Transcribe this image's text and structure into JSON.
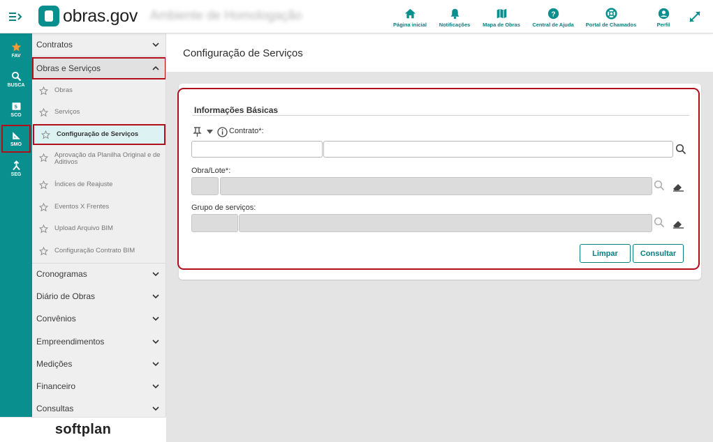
{
  "app": {
    "logo_text": "obras.gov",
    "environment": "Ambiente de Homologação"
  },
  "topnav": [
    {
      "label": "Página inicial",
      "icon": "home-icon"
    },
    {
      "label": "Notificações",
      "icon": "bell-icon"
    },
    {
      "label": "Mapa de Obras",
      "icon": "map-icon"
    },
    {
      "label": "Central de Ajuda",
      "icon": "help-icon"
    },
    {
      "label": "Portal de Chamados",
      "icon": "lifebuoy-icon"
    },
    {
      "label": "Perfil",
      "icon": "user-icon"
    }
  ],
  "rail": [
    {
      "label": "FAV",
      "icon": "star-icon"
    },
    {
      "label": "BUSCA",
      "icon": "search-icon"
    },
    {
      "label": "SCO",
      "icon": "sco-icon",
      "badge": "5"
    },
    {
      "label": "SMO",
      "icon": "ruler-icon"
    },
    {
      "label": "SEG",
      "icon": "seg-icon"
    }
  ],
  "sidebar": {
    "contratos": "Contratos",
    "obras_servicos": "Obras e Serviços",
    "subitems": [
      "Obras",
      "Serviços",
      "Configuração de Serviços",
      "Aprovação da Planilha Original e de Aditivos",
      "Índices de Reajuste",
      "Eventos X Frentes",
      "Upload Arquivo BIM",
      "Configuração Contrato BIM"
    ],
    "sections": [
      "Cronogramas",
      "Diário de Obras",
      "Convênios",
      "Empreendimentos",
      "Medições",
      "Financeiro",
      "Consultas"
    ]
  },
  "footer": {
    "brand": "softplan"
  },
  "main": {
    "page_title": "Configuração de Serviços",
    "section_title": "Informações Básicas",
    "fields": {
      "contrato_label": "Contrato*:",
      "obra_label": "Obra/Lote*:",
      "grupo_label": "Grupo de serviços:"
    },
    "buttons": {
      "limpar": "Limpar",
      "consultar": "Consultar"
    }
  },
  "colors": {
    "primary": "#0a8f8f",
    "highlight": "#b10e1c",
    "sidebar_bg": "#efefef",
    "content_bg": "#e4e4e4"
  }
}
